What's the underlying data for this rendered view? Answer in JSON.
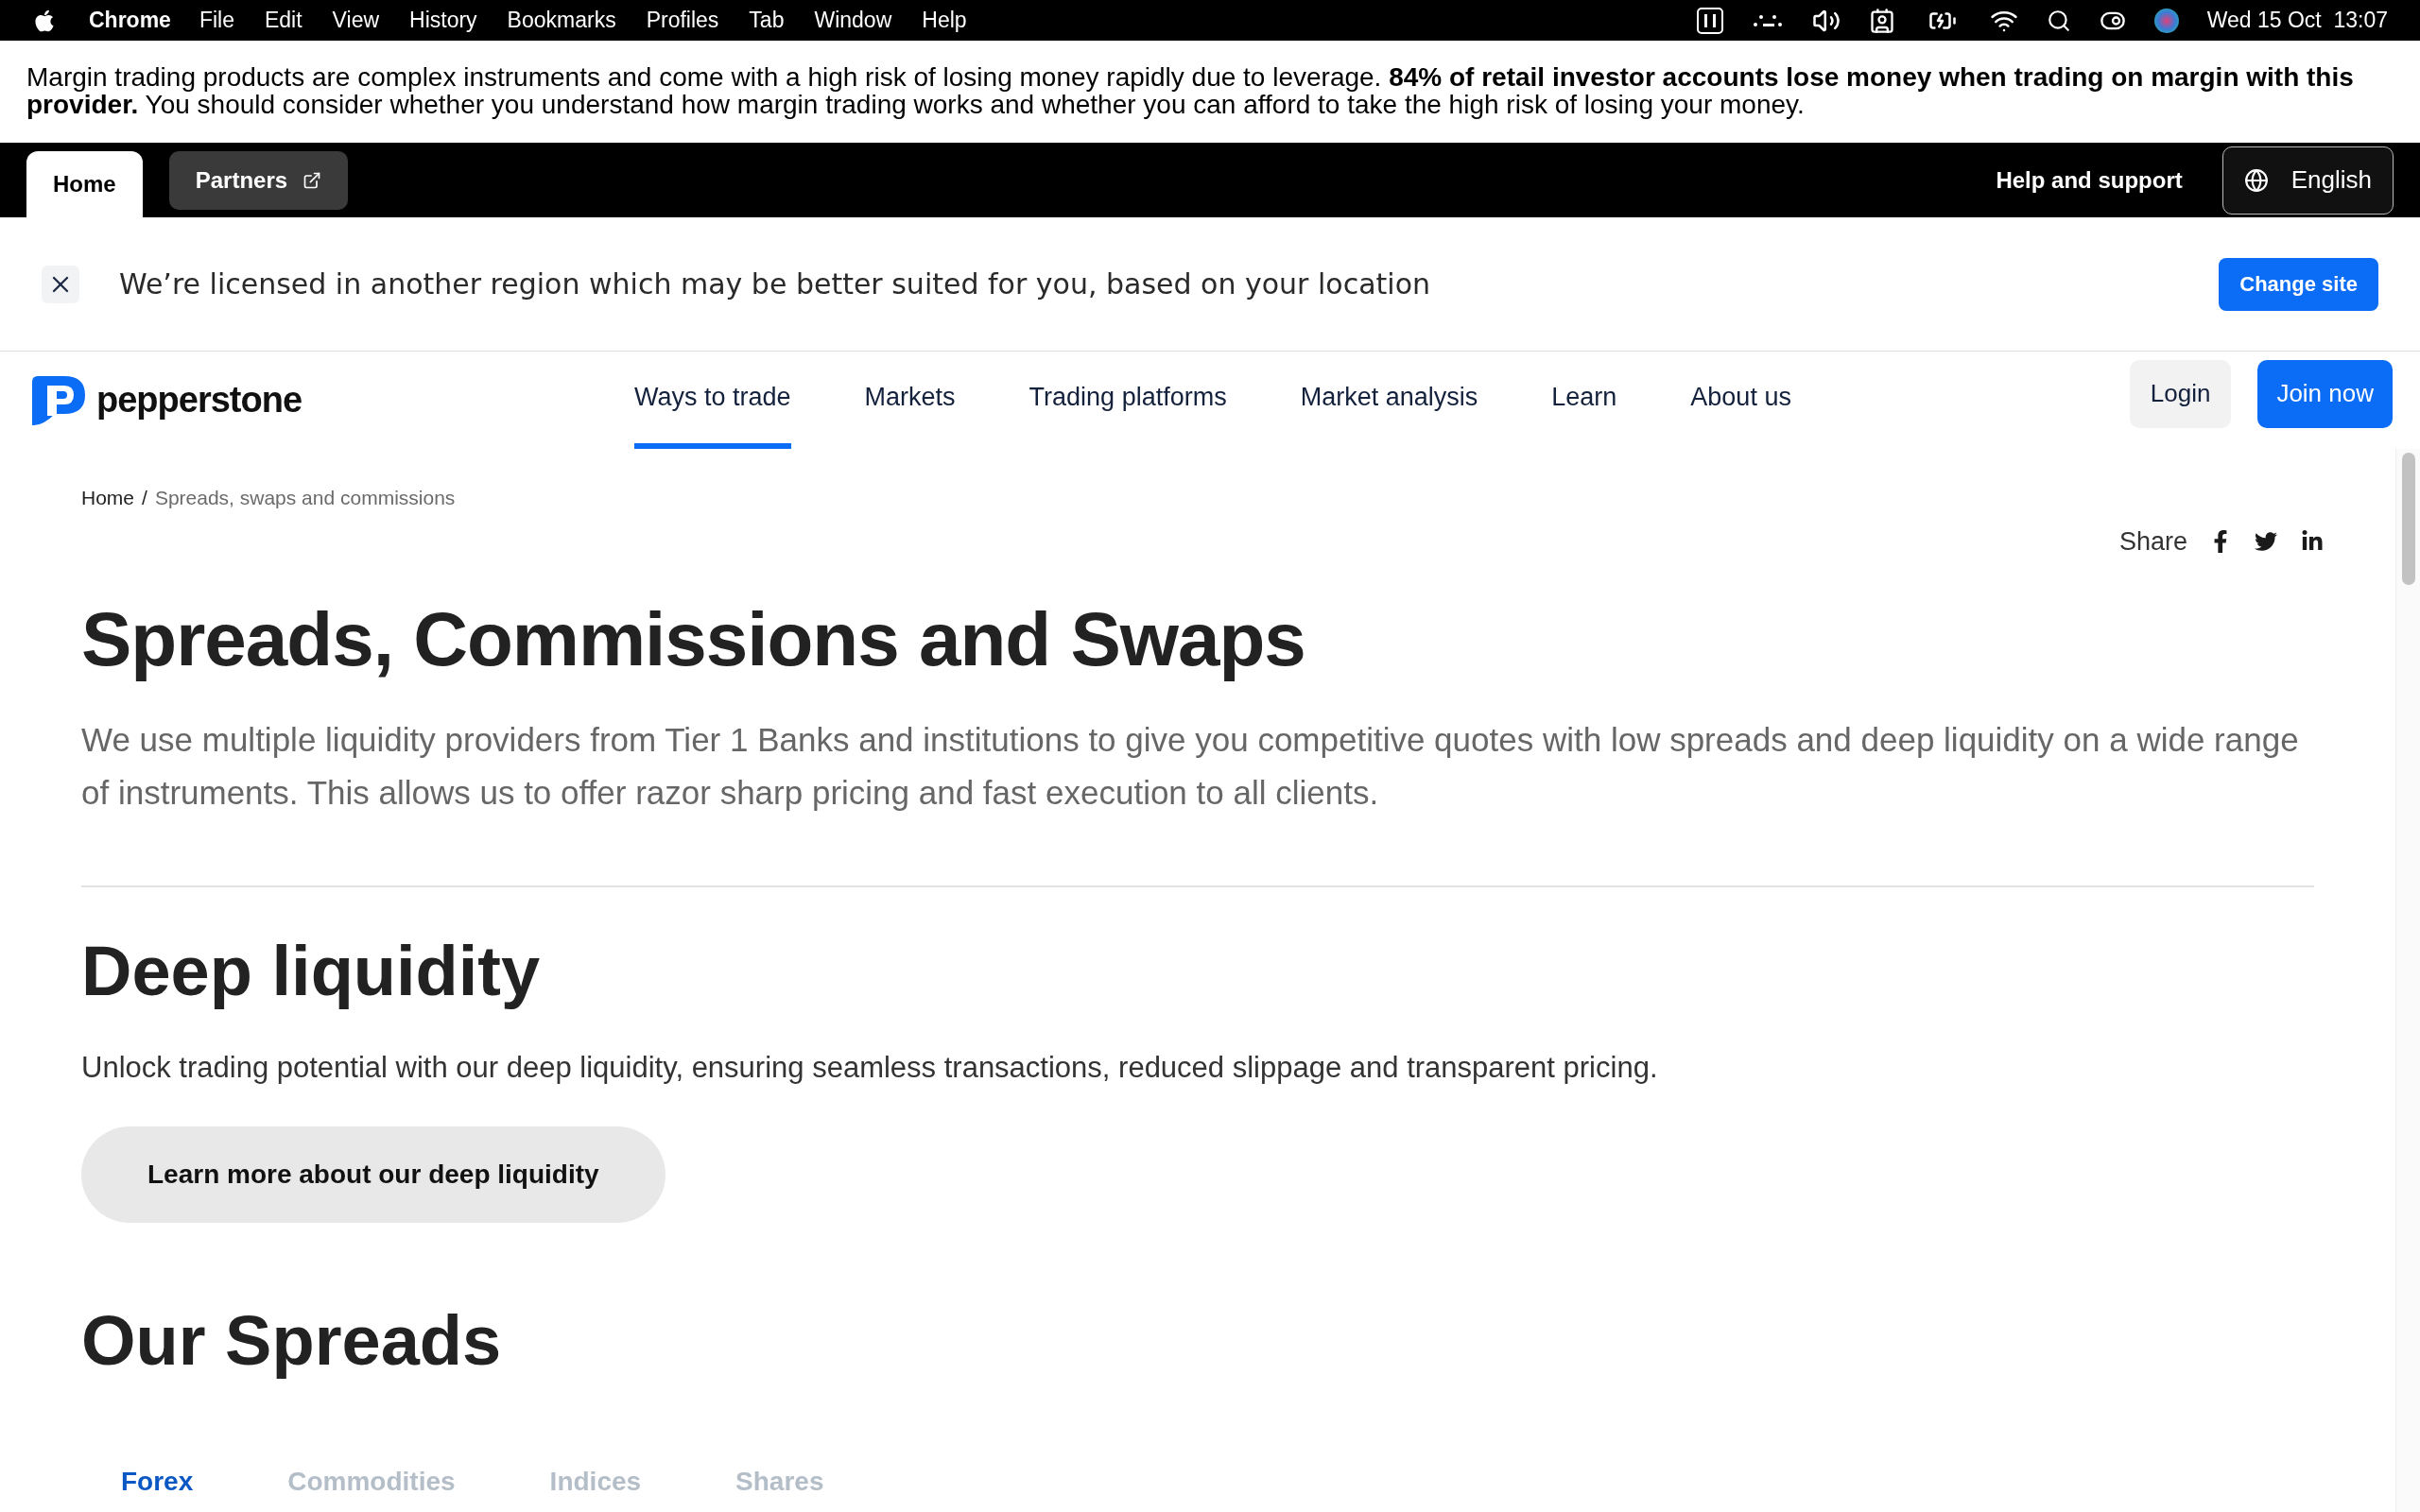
{
  "menubar": {
    "app": "Chrome",
    "menus": [
      "File",
      "Edit",
      "View",
      "History",
      "Bookmarks",
      "Profiles",
      "Tab",
      "Window",
      "Help"
    ],
    "clock": "Wed 15 Oct  13:07"
  },
  "disclaimer": "Margin trading products are complex instruments and come with a high risk of losing money rapidly due to leverage. **84% of retail investor accounts lose money when trading on margin with this provider.** You should consider whether you understand how margin trading works and whether you can afford to take the high risk of losing your money.",
  "topnav": {
    "tabs": [
      {
        "label": "Home",
        "selected": true,
        "external": false
      },
      {
        "label": "Partners",
        "selected": false,
        "external": true
      }
    ],
    "help": "Help and support",
    "language": "English"
  },
  "region_banner": {
    "text": "We’re licensed in another region which may be better suited for you, based on your location",
    "button": "Change site"
  },
  "mainnav": {
    "logo": "pepperstone",
    "items": [
      {
        "label": "Ways to trade",
        "selected": true
      },
      {
        "label": "Markets",
        "selected": false
      },
      {
        "label": "Trading platforms",
        "selected": false
      },
      {
        "label": "Market analysis",
        "selected": false
      },
      {
        "label": "Learn",
        "selected": false
      },
      {
        "label": "About us",
        "selected": false
      }
    ],
    "login": "Login",
    "join": "Join now"
  },
  "breadcrumb": {
    "home": "Home",
    "separator": "/",
    "current": "Spreads, swaps and commissions"
  },
  "share": {
    "label": "Share"
  },
  "title": "Spreads, Commissions and Swaps",
  "intro": "We use multiple liquidity providers from Tier 1 Banks and institutions to give you competitive quotes with low spreads and deep liquidity on a wide range of instruments. This allows us to offer razor sharp pricing and fast execution to all clients.",
  "deep_liquidity": {
    "heading": "Deep liquidity",
    "text": "Unlock trading potential with our deep liquidity, ensuring seamless transactions, reduced slippage and transparent pricing.",
    "button": "Learn more about our deep liquidity"
  },
  "spreads": {
    "heading": "Our Spreads",
    "tabs": [
      {
        "label": "Forex",
        "selected": true
      },
      {
        "label": "Commodities",
        "selected": false
      },
      {
        "label": "Indices",
        "selected": false
      },
      {
        "label": "Shares",
        "selected": false
      }
    ]
  }
}
